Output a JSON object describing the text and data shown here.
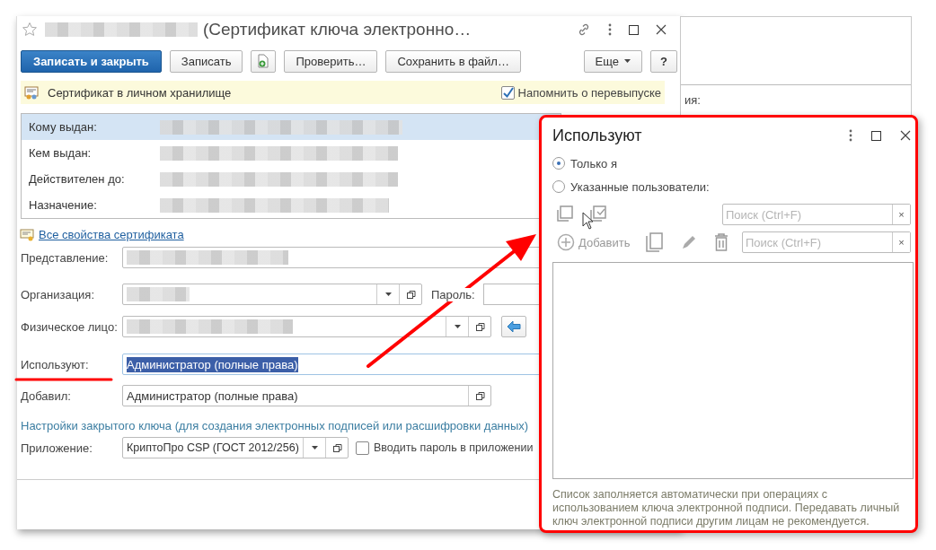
{
  "back_window": {
    "label_fragment": "ия:"
  },
  "main_window": {
    "title": "(Сертификат ключа электронно…",
    "toolbar": [
      {
        "kind": "primary",
        "label": "Записать и закрыть"
      },
      {
        "kind": "plain",
        "label": "Записать"
      },
      {
        "kind": "icon"
      },
      {
        "kind": "plain",
        "label": "Проверить…"
      },
      {
        "kind": "plain",
        "label": "Сохранить в файл…"
      },
      {
        "kind": "menu",
        "label": "Еще"
      },
      {
        "kind": "plain",
        "label": "?"
      }
    ],
    "info_bar": {
      "text": "Сертификат в личном хранилище",
      "remind": {
        "label": "Напомнить о перевыпуске",
        "checked": true
      }
    },
    "cert_rows": [
      {
        "label": "Кому выдан:",
        "selected": true
      },
      {
        "label": "Кем выдан:",
        "selected": false
      },
      {
        "label": "Действителен до:",
        "selected": false
      },
      {
        "label": "Назначение:",
        "selected": false
      }
    ],
    "properties_link": "Все свойства сертификата",
    "fields": [
      {
        "label": "Представление:",
        "kind": "text"
      },
      {
        "label": "Организация:",
        "kind": "select",
        "side_label": "Пароль:"
      },
      {
        "label": "Физическое лицо:",
        "kind": "action"
      },
      {
        "label": "Используют:",
        "value": "Администратор (полные права)",
        "kind": "highlighted"
      },
      {
        "label": "Добавил:",
        "value": "Администратор (полные права)",
        "kind": "ref"
      }
    ],
    "key_section": {
      "heading": "Настройки закрытого ключа (для создания электронных подписей или расшифровки данных)",
      "app_label": "Приложение:",
      "app_value": "КриптоПро CSP (ГОСТ 2012/256)",
      "password_option": {
        "label": "Вводить пароль в приложении",
        "checked": false
      }
    }
  },
  "users_dialog": {
    "title": "Используют",
    "options": [
      {
        "label": "Только я",
        "selected": true
      },
      {
        "label": "Указанные пользователи:",
        "selected": false
      }
    ],
    "searches": [
      {
        "placeholder": "Поиск (Ctrl+F)",
        "clear": "×"
      },
      {
        "placeholder": "Поиск (Ctrl+F)",
        "clear": "×"
      }
    ],
    "add_label": "Добавить",
    "note": "Список заполняется автоматически при операциях с использованием ключа электронной подписи. Передавать личный ключ электронной подписи другим лицам не рекомендуется."
  }
}
